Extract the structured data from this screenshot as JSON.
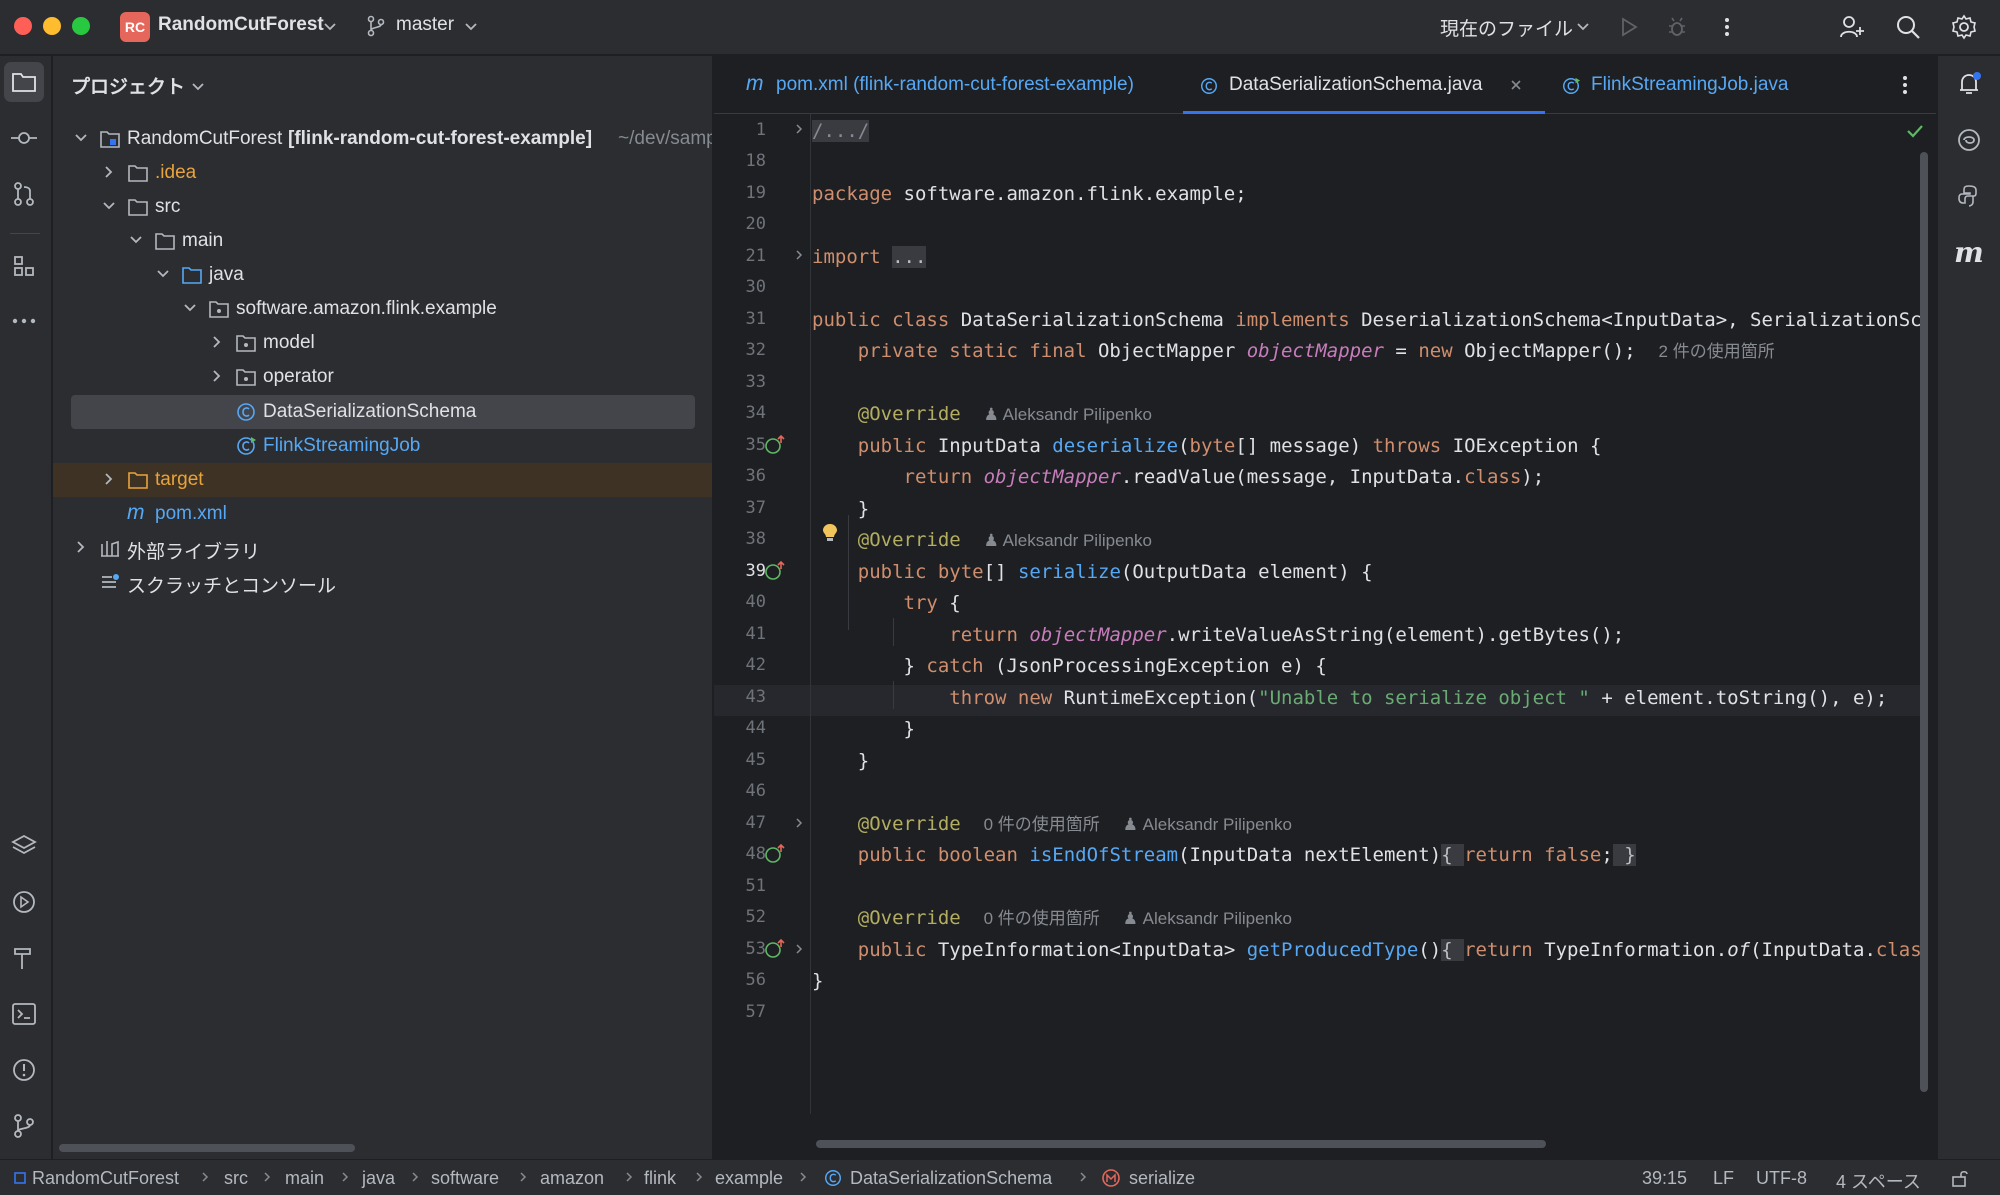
{
  "window": {
    "project_badge": "RC",
    "project_name": "RandomCutForest",
    "branch": "master",
    "run_config": "現在のファイル"
  },
  "project_panel": {
    "title": "プロジェクト",
    "root_name": "RandomCutForest",
    "root_module": "[flink-random-cut-forest-example]",
    "root_path": "~/dev/samples",
    "items": [
      {
        "label": ".idea"
      },
      {
        "label": "src"
      },
      {
        "label": "main"
      },
      {
        "label": "java"
      },
      {
        "label": "software.amazon.flink.example"
      },
      {
        "label": "model"
      },
      {
        "label": "operator"
      },
      {
        "label": "DataSerializationSchema"
      },
      {
        "label": "FlinkStreamingJob"
      },
      {
        "label": "target"
      },
      {
        "label": "pom.xml"
      },
      {
        "label": "外部ライブラリ"
      },
      {
        "label": "スクラッチとコンソール"
      }
    ]
  },
  "tabs": [
    {
      "label": "pom.xml (flink-random-cut-forest-example)",
      "icon": "m"
    },
    {
      "label": "DataSerializationSchema.java",
      "icon": "C"
    },
    {
      "label": "FlinkStreamingJob.java",
      "icon": "C"
    }
  ],
  "editor": {
    "line_numbers": [
      "1",
      "18",
      "19",
      "20",
      "21",
      "30",
      "31",
      "32",
      "33",
      "34",
      "35",
      "36",
      "37",
      "38",
      "39",
      "40",
      "41",
      "42",
      "43",
      "44",
      "45",
      "46",
      "47",
      "48",
      "51",
      "52",
      "53",
      "56",
      "57"
    ],
    "current_line": "39",
    "author": "Aleksandr Pilipenko",
    "usages_2": "2 件の使用箇所",
    "usages_0": "0 件の使用箇所",
    "code": {
      "l1": "/.../",
      "l19_kw": "package",
      "l19_rest": " software.amazon.flink.example;",
      "l21_kw": "import",
      "l21_fold": "...",
      "l31_a": "public class",
      "l31_b": " DataSerializationSchema ",
      "l31_c": "implements",
      "l31_d": " DeserializationSchema<InputData>, SerializationSchema<OutputData> {",
      "l32_a": "    private static final",
      "l32_b": " ObjectMapper ",
      "l32_c": "objectMapper",
      "l32_d": " = ",
      "l32_e": "new",
      "l32_f": " ObjectMapper();  ",
      "override": "@Override",
      "l35_a": "public",
      "l35_b": " InputData ",
      "l35_c": "deserialize",
      "l35_d": "(",
      "l35_e": "byte",
      "l35_f": "[] message) ",
      "l35_g": "throws",
      "l35_h": " IOException {",
      "l36_a": "return",
      "l36_b": "objectMapper",
      "l36_c": ".readValue(message, InputData.",
      "l36_d": "class",
      "l36_e": ");",
      "close": "}",
      "l39_a": "public",
      "l39_b": " ",
      "l39_c": "byte",
      "l39_d": "[] ",
      "l39_e": "serialize",
      "l39_f": "(OutputData element) {",
      "l40_a": "try",
      "l40_b": " {",
      "l41_a": "return",
      "l41_b": "objectMapper",
      "l41_c": ".writeValueAsString(element).getBytes();",
      "l42_a": "} ",
      "l42_b": "catch",
      "l42_c": " (JsonProcessingException e) {",
      "l43_a": "throw new",
      "l43_b": " RuntimeException(",
      "l43_c": "\"Unable to serialize object \"",
      "l43_d": " + element.toString(), e);",
      "l48_a": "public boolean",
      "l48_b": " ",
      "l48_c": "isEndOfStream",
      "l48_d": "(InputData nextElement)",
      "l48_e": "{ ",
      "l48_f": "return false",
      "l48_g": ";",
      "l48_h": " }",
      "l53_a": "public",
      "l53_b": " TypeInformation<InputData> ",
      "l53_c": "getProducedType",
      "l53_d": "()",
      "l53_e": "{ ",
      "l53_f": "return",
      "l53_g": " TypeInformation.",
      "l53_h": "of",
      "l53_i": "(InputData.",
      "l53_j": "class",
      "l53_k": "); }"
    }
  },
  "statusbar": {
    "crumbs": [
      "RandomCutForest",
      "src",
      "main",
      "java",
      "software",
      "amazon",
      "flink",
      "example",
      "DataSerializationSchema",
      "serialize"
    ],
    "position": "39:15",
    "line_sep": "LF",
    "encoding": "UTF-8",
    "indent": "4 スペース"
  },
  "colors": {
    "accent": "#3574f0",
    "keyword": "#cf8e6d",
    "function": "#56a8f5",
    "field": "#c77dbb",
    "annotation": "#b3ae60",
    "string": "#6aab73"
  }
}
